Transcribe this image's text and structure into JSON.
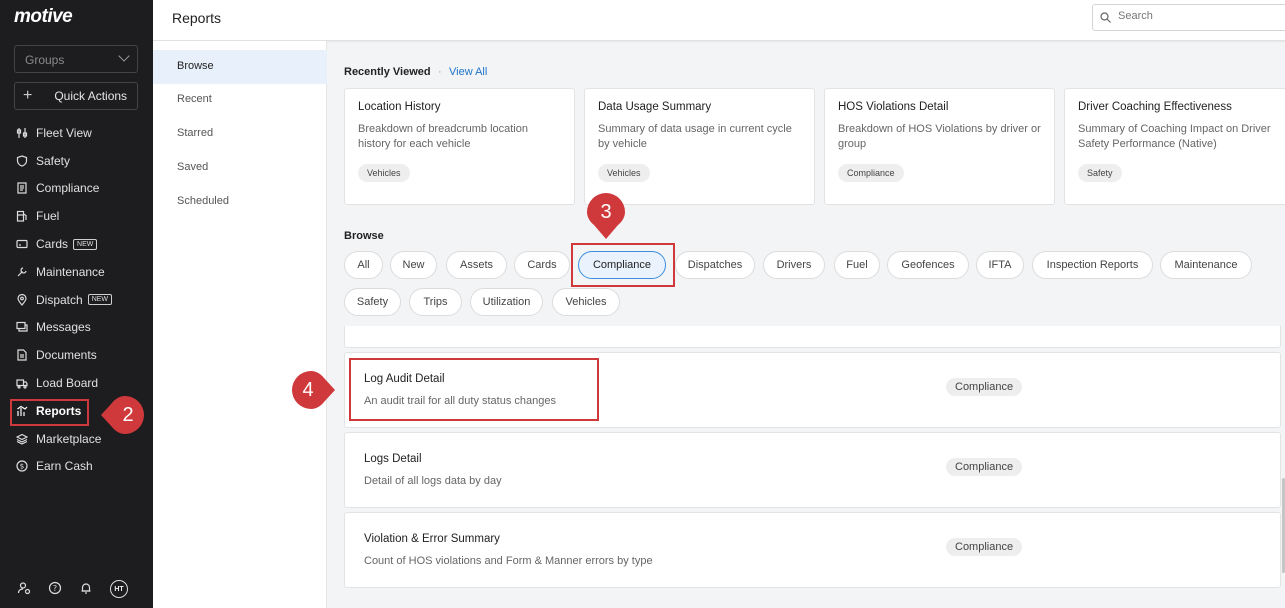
{
  "brand": {
    "logo": "motive"
  },
  "sidebar": {
    "groups_placeholder": "Groups",
    "quick_actions": "Quick Actions",
    "items": [
      {
        "label": "Fleet View",
        "icon": "sliders-icon"
      },
      {
        "label": "Safety",
        "icon": "shield-icon"
      },
      {
        "label": "Compliance",
        "icon": "document-icon"
      },
      {
        "label": "Fuel",
        "icon": "fuel-pump-icon"
      },
      {
        "label": "Cards",
        "icon": "card-icon",
        "badge": "NEW"
      },
      {
        "label": "Maintenance",
        "icon": "wrench-icon"
      },
      {
        "label": "Dispatch",
        "icon": "location-pin-icon",
        "badge": "NEW"
      },
      {
        "label": "Messages",
        "icon": "message-icon"
      },
      {
        "label": "Documents",
        "icon": "file-icon"
      },
      {
        "label": "Load Board",
        "icon": "truck-icon"
      },
      {
        "label": "Reports",
        "icon": "chart-icon",
        "active": true
      },
      {
        "label": "Marketplace",
        "icon": "layers-icon"
      },
      {
        "label": "Earn Cash",
        "icon": "dollar-icon"
      }
    ],
    "user_initials": "HT"
  },
  "header": {
    "title": "Reports",
    "search_placeholder": "Search"
  },
  "subnav": {
    "items": [
      "Browse",
      "Recent",
      "Starred",
      "Saved",
      "Scheduled"
    ],
    "active": "Browse"
  },
  "recently_viewed": {
    "title": "Recently Viewed",
    "separator": "·",
    "view_all": "View All",
    "cards": [
      {
        "title": "Location History",
        "desc": "Breakdown of breadcrumb location history for each vehicle",
        "tag": "Vehicles"
      },
      {
        "title": "Data Usage Summary",
        "desc": "Summary of data usage in current cycle by vehicle",
        "tag": "Vehicles"
      },
      {
        "title": "HOS Violations Detail",
        "desc": "Breakdown of HOS Violations by driver or group",
        "tag": "Compliance"
      },
      {
        "title": "Driver Coaching Effectiveness",
        "desc": "Summary of Coaching Impact on Driver Safety Performance (Native)",
        "tag": "Safety"
      }
    ]
  },
  "browse": {
    "title": "Browse",
    "filters": [
      "All",
      "New",
      "Assets",
      "Cards",
      "Compliance",
      "Dispatches",
      "Drivers",
      "Fuel",
      "Geofences",
      "IFTA",
      "Inspection Reports",
      "Maintenance",
      "Safety",
      "Trips",
      "Utilization",
      "Vehicles"
    ],
    "active_filter": "Compliance"
  },
  "reports": [
    {
      "title": "Log Audit Detail",
      "desc": "An audit trail for all duty status changes",
      "tag": "Compliance"
    },
    {
      "title": "Logs Detail",
      "desc": "Detail of all logs data by day",
      "tag": "Compliance"
    },
    {
      "title": "Violation & Error Summary",
      "desc": "Count of HOS violations and Form & Manner errors by type",
      "tag": "Compliance"
    }
  ],
  "annotations": {
    "marker_2": "2",
    "marker_3": "3",
    "marker_4": "4",
    "color": "#d0393b"
  }
}
